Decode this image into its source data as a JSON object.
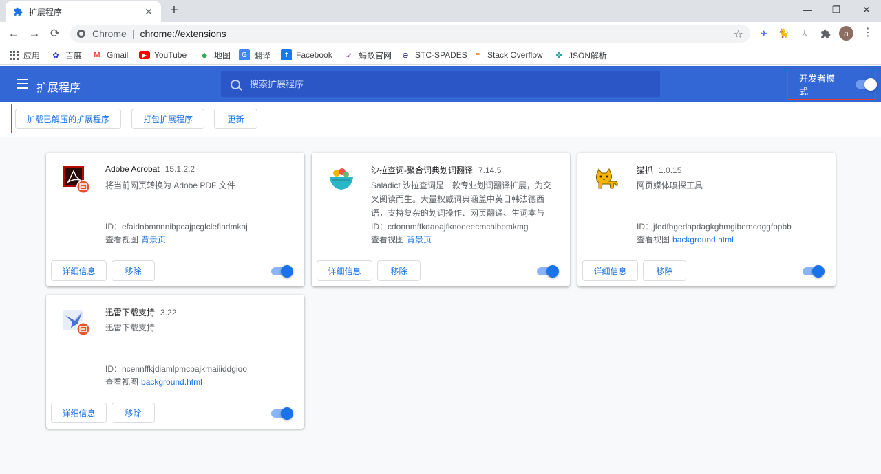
{
  "browser": {
    "tab": {
      "title": "扩展程序",
      "icon": "puzzle-icon"
    },
    "new_tab": "+",
    "window_controls": {
      "minimize": "—",
      "restore": "❐",
      "close": "✕"
    },
    "omnibox": {
      "scheme": "Chrome",
      "url": "chrome://extensions"
    },
    "profile_initial": "a",
    "bookmarks": [
      {
        "label": "应用",
        "icon": "apps-grid-icon",
        "color": "#4285f4"
      },
      {
        "label": "百度",
        "icon": "baidu-paw-icon",
        "color": "#2932e1"
      },
      {
        "label": "Gmail",
        "icon": "gmail-icon",
        "color": "#ea4335"
      },
      {
        "label": "YouTube",
        "icon": "youtube-icon",
        "color": "#ff0000"
      },
      {
        "label": "地图",
        "icon": "maps-icon",
        "color": "#34a853"
      },
      {
        "label": "翻译",
        "icon": "translate-icon",
        "color": "#4285f4"
      },
      {
        "label": "Facebook",
        "icon": "facebook-icon",
        "color": "#1877f2"
      },
      {
        "label": "蚂蚁官网",
        "icon": "ant-icon",
        "color": "#7b1fa2"
      },
      {
        "label": "STC-SPADES",
        "icon": "stc-icon",
        "color": "#1a237e"
      },
      {
        "label": "Stack Overflow",
        "icon": "stackoverflow-icon",
        "color": "#f48024"
      },
      {
        "label": "JSON解析",
        "icon": "json-icon",
        "color": "#26a69a"
      }
    ]
  },
  "header": {
    "title": "扩展程序",
    "search_placeholder": "搜索扩展程序",
    "dev_mode_label": "开发者模式",
    "dev_mode_on": true
  },
  "dev_toolbar": {
    "load_unpacked": "加载已解压的扩展程序",
    "pack": "打包扩展程序",
    "update": "更新"
  },
  "extensions": [
    {
      "name": "Adobe Acrobat",
      "version": "15.1.2.2",
      "description": "将当前网页转换为 Adobe PDF 文件",
      "id": "ID：efaidnbmnnnibpcajpcglclefindmkaj",
      "views_label": "查看视图",
      "view_link": "背景页",
      "details": "详细信息",
      "remove": "移除",
      "enabled": true
    },
    {
      "name": "沙拉查词-聚合词典划词翻译",
      "version": "7.14.5",
      "description": "Saladict 沙拉查词是一款专业划词翻译扩展，为交叉阅读而生。大量权威词典涵盖中英日韩法德西语，支持复杂的划词操作、网页翻译、生词本与",
      "id": "ID：cdonnmffkdaoajfknoeeecmchibpmkmg",
      "views_label": "查看视图",
      "view_link": "背景页",
      "details": "详细信息",
      "remove": "移除",
      "enabled": true
    },
    {
      "name": "猫抓",
      "version": "1.0.15",
      "description": "网页媒体嗅探工具",
      "id": "ID：jfedfbgedapdagkghmgibemcoggfppbb",
      "views_label": "查看视图",
      "view_link": "background.html",
      "details": "详细信息",
      "remove": "移除",
      "enabled": true
    },
    {
      "name": "迅雷下载支持",
      "version": "3.22",
      "description": "迅雷下载支持",
      "id": "ID：ncennffkjdiamlpmcbajkmaiiiddgioo",
      "views_label": "查看视图",
      "view_link": "background.html",
      "details": "详细信息",
      "remove": "移除",
      "enabled": true
    }
  ],
  "colors": {
    "header_blue": "#3367d6",
    "search_blue": "#2a56c6",
    "link_blue": "#1a73e8",
    "highlight_red": "#e53935"
  }
}
